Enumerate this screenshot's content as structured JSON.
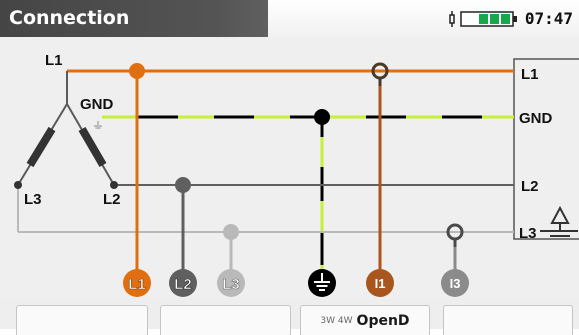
{
  "header": {
    "title": "Connection",
    "time": "07:47"
  },
  "instrument": {
    "labels": {
      "l1": "L1",
      "gnd": "GND",
      "l2": "L2",
      "l3": "L3"
    }
  },
  "source": {
    "labels": {
      "l1": "L1",
      "gnd": "GND",
      "l3": "L3",
      "l2": "L2"
    }
  },
  "terminals": [
    "L1",
    "L2",
    "L3",
    "I1",
    "I3"
  ],
  "softkeys": {
    "key3_options": "3W 4W",
    "key3_value": "OpenD"
  },
  "colors": {
    "l1": "#e06f12",
    "l2": "#5f5f5f",
    "l3": "#b9b9b9",
    "gnd_black": "#000000",
    "gnd_green": "#c6ee3b",
    "i1": "#a9561e",
    "i3": "#8b8b8b"
  }
}
